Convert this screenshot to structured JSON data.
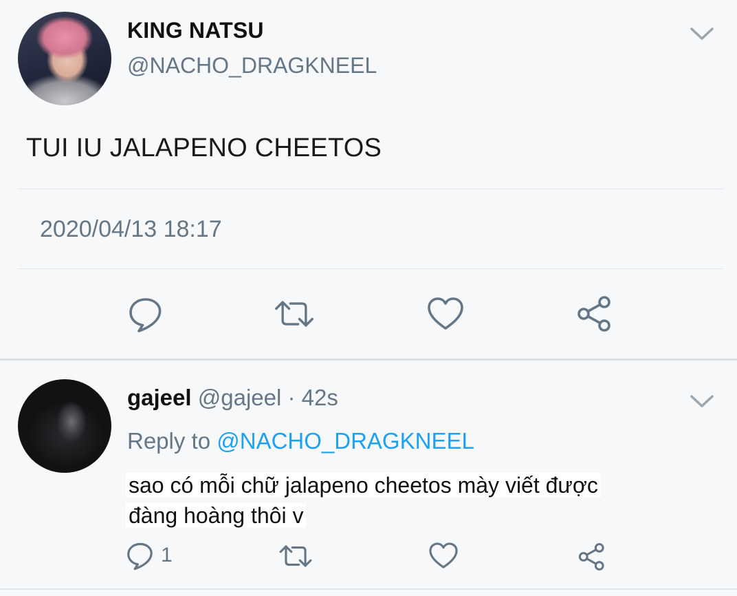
{
  "main_tweet": {
    "display_name": "KING NATSU",
    "handle": "@NACHO_DRAGKNEEL",
    "text": "TUI IU JALAPENO CHEETOS",
    "timestamp": "2020/04/13 18:17",
    "actions": [
      "reply-icon",
      "retweet-icon",
      "like-icon",
      "share-icon"
    ]
  },
  "reply_tweet": {
    "display_name": "gajeel",
    "handle": "@gajeel",
    "separator": "·",
    "time": "42s",
    "reply_to_prefix": "Reply to",
    "reply_to_user": "@NACHO_DRAGKNEEL",
    "text_line1": "sao có mỗi chữ jalapeno cheetos mày viết được",
    "text_line2": "đàng hoàng thôi v",
    "reply_count": "1",
    "actions": [
      "reply-icon",
      "retweet-icon",
      "like-icon",
      "share-icon"
    ]
  },
  "colors": {
    "background": "#f7f8fa",
    "secondary_text": "#657786",
    "link": "#1da1f2",
    "icon": "#657786"
  }
}
